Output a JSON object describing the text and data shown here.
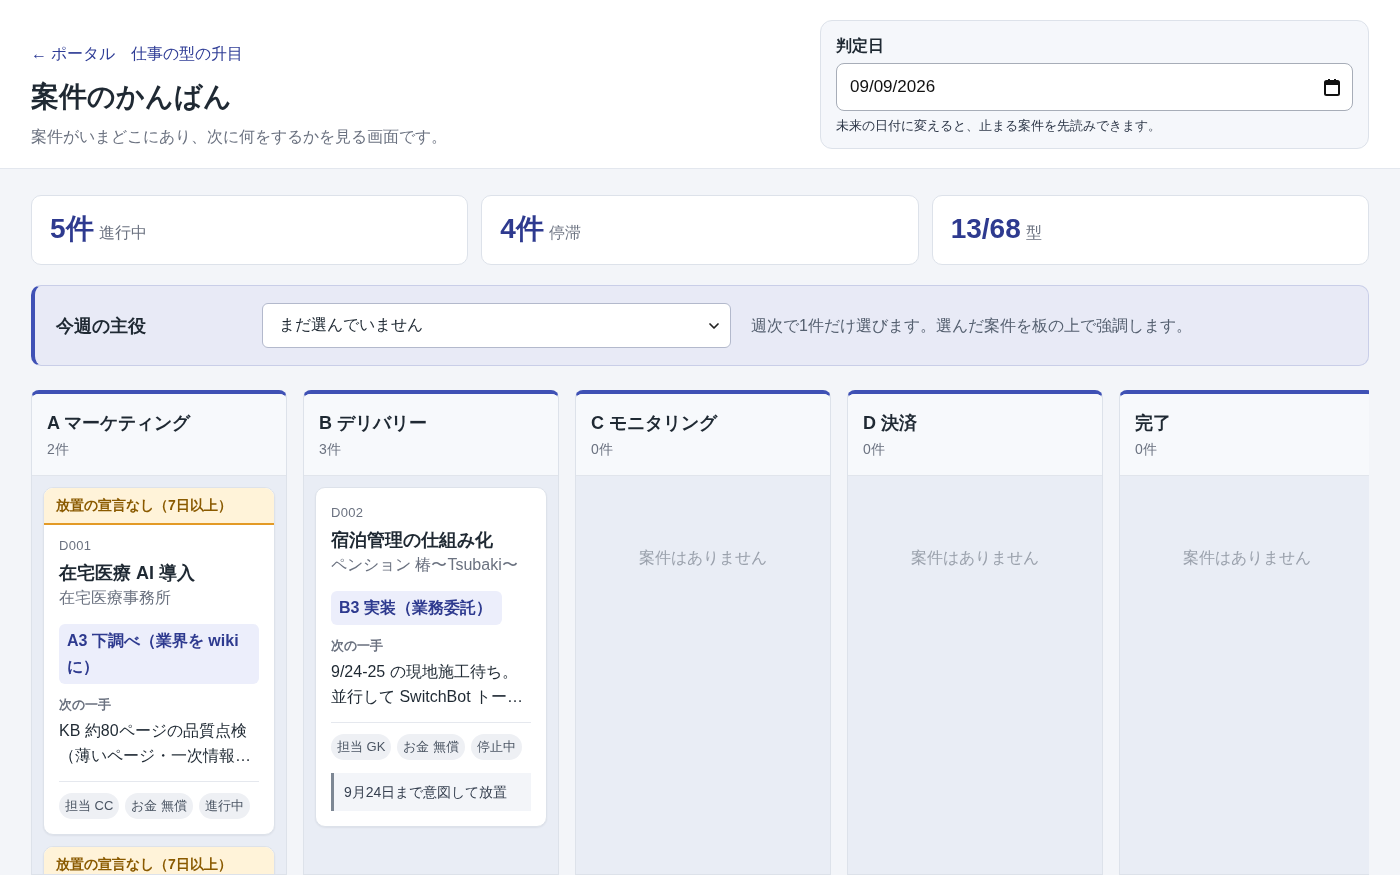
{
  "breadcrumb": [
    {
      "label": "← ポータル"
    },
    {
      "label": "仕事の型の升目"
    }
  ],
  "title": "案件のかんばん",
  "subtitle": "案件がいまどこにあり、次に何をするかを見る画面です。",
  "judgement_date": {
    "label": "判定日",
    "value": "09/09/2026",
    "hint": "未来の日付に変えると、止まる案件を先読みできます。"
  },
  "stats": [
    {
      "value": "5件",
      "label": "進行中"
    },
    {
      "value": "4件",
      "label": "停滞"
    },
    {
      "value": "13/68",
      "label": "型"
    }
  ],
  "week_focus": {
    "label": "今週の主役",
    "value": "まだ選んでいません",
    "hint": "週次で1件だけ選びます。選んだ案件を板の上で強調します。"
  },
  "columns": [
    {
      "title": "A マーケティング",
      "count": "2件",
      "cards": [
        {
          "warning": "放置の宣言なし（7日以上）",
          "id": "D001",
          "title": "在宅医療 AI 導入",
          "client": "在宅医療事務所",
          "stage": "A3 下調べ（業界を wiki に）",
          "next_label": "次の一手",
          "next": "KB 約80ページの品質点検（薄いページ・一次情報…",
          "tags": [
            "担当 CC",
            "お金 無償",
            "進行中"
          ]
        },
        {
          "warning": "放置の宣言なし（7日以上）"
        }
      ]
    },
    {
      "title": "B デリバリー",
      "count": "3件",
      "cards": [
        {
          "id": "D002",
          "title": "宿泊管理の仕組み化",
          "client": "ペンション 椿〜Tsubaki〜",
          "stage": "B3 実装（業務委託）",
          "next_label": "次の一手",
          "next": "9/24-25 の現地施工待ち。並行して SwitchBot トー…",
          "tags": [
            "担当 GK",
            "お金 無償",
            "停止中"
          ],
          "note": "9月24日まで意図して放置"
        }
      ]
    },
    {
      "title": "C モニタリング",
      "count": "0件",
      "empty_text": "案件はありません"
    },
    {
      "title": "D 決済",
      "count": "0件",
      "empty_text": "案件はありません"
    },
    {
      "title": "完了",
      "count": "0件",
      "empty_text": "案件はありません"
    }
  ]
}
